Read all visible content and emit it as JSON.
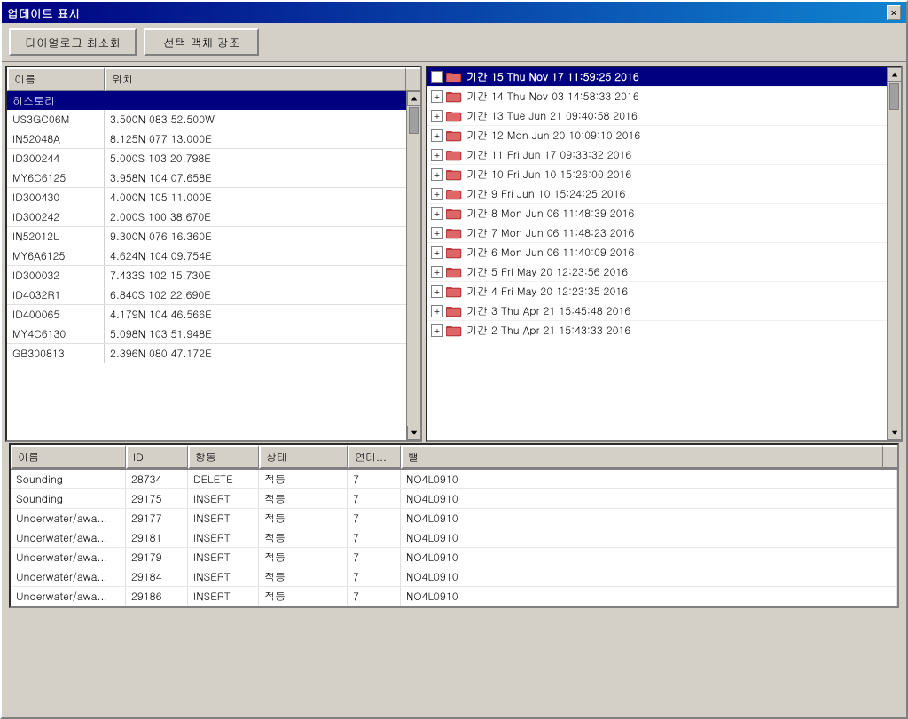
{
  "window": {
    "title": "업데이트 표시",
    "close_label": "×"
  },
  "toolbar": {
    "btn1_label": "다이얼로그 최소화",
    "btn2_label": "선택 객체 강조"
  },
  "left_panel": {
    "col_name": "이름",
    "col_pos": "위치",
    "history_label": "히스토리",
    "rows": [
      {
        "name": "US3GC06M",
        "pos": "3.500N 083 52.500W"
      },
      {
        "name": "IN52048A",
        "pos": "8.125N 077 13.000E"
      },
      {
        "name": "ID300244",
        "pos": "5.000S 103 20.798E"
      },
      {
        "name": "MY6C6125",
        "pos": "3.958N 104 07.658E"
      },
      {
        "name": "ID300430",
        "pos": "4.000N 105 11.000E"
      },
      {
        "name": "ID300242",
        "pos": "2.000S 100 38.670E"
      },
      {
        "name": "IN52012L",
        "pos": "9.300N 076 16.360E"
      },
      {
        "name": "MY6A6125",
        "pos": "4.624N 104 09.754E"
      },
      {
        "name": "ID300032",
        "pos": "7.433S 102 15.730E"
      },
      {
        "name": "ID4032R1",
        "pos": "6.840S 102 22.690E"
      },
      {
        "name": "ID400065",
        "pos": "4.179N 104 46.566E"
      },
      {
        "name": "MY4C6130",
        "pos": "5.098N 103 51.948E"
      },
      {
        "name": "GB300813",
        "pos": "2.396N 080 47.172E"
      }
    ]
  },
  "right_panel": {
    "items": [
      {
        "id": 15,
        "label": "기간 15 Thu Nov 17 11:59:25 2016",
        "selected": true
      },
      {
        "id": 14,
        "label": "기간 14 Thu Nov 03 14:58:33 2016",
        "selected": false
      },
      {
        "id": 13,
        "label": "기간 13 Tue Jun 21 09:40:58 2016",
        "selected": false
      },
      {
        "id": 12,
        "label": "기간 12 Mon Jun 20 10:09:10 2016",
        "selected": false
      },
      {
        "id": 11,
        "label": "기간 11 Fri Jun 17 09:33:32 2016",
        "selected": false
      },
      {
        "id": 10,
        "label": "기간 10 Fri Jun 10 15:26:00 2016",
        "selected": false
      },
      {
        "id": 9,
        "label": "기간 9 Fri Jun 10 15:24:25 2016",
        "selected": false
      },
      {
        "id": 8,
        "label": "기간 8 Mon Jun 06 11:48:39 2016",
        "selected": false
      },
      {
        "id": 7,
        "label": "기간 7 Mon Jun 06 11:48:23 2016",
        "selected": false
      },
      {
        "id": 6,
        "label": "기간 6 Mon Jun 06 11:40:09 2016",
        "selected": false
      },
      {
        "id": 5,
        "label": "기간 5 Fri May 20 12:23:56 2016",
        "selected": false
      },
      {
        "id": 4,
        "label": "기간 4 Fri May 20 12:23:35 2016",
        "selected": false
      },
      {
        "id": 3,
        "label": "기간 3 Thu Apr 21 15:45:48 2016",
        "selected": false
      },
      {
        "id": 2,
        "label": "기간 2 Thu Apr 21 15:43:33 2016",
        "selected": false
      }
    ]
  },
  "bottom_panel": {
    "headers": {
      "name": "이름",
      "id": "ID",
      "action": "항동",
      "status": "상태",
      "priority": "연데...",
      "value": "밸"
    },
    "rows": [
      {
        "name": "Sounding",
        "id": "28734",
        "action": "DELETE",
        "status": "적등",
        "priority": "7",
        "value": "NO4L0910"
      },
      {
        "name": "Sounding",
        "id": "29175",
        "action": "INSERT",
        "status": "적등",
        "priority": "7",
        "value": "NO4L0910"
      },
      {
        "name": "Underwater/awa...",
        "id": "29177",
        "action": "INSERT",
        "status": "적등",
        "priority": "7",
        "value": "NO4L0910"
      },
      {
        "name": "Underwater/awa...",
        "id": "29181",
        "action": "INSERT",
        "status": "적등",
        "priority": "7",
        "value": "NO4L0910"
      },
      {
        "name": "Underwater/awa...",
        "id": "29179",
        "action": "INSERT",
        "status": "적등",
        "priority": "7",
        "value": "NO4L0910"
      },
      {
        "name": "Underwater/awa...",
        "id": "29184",
        "action": "INSERT",
        "status": "적등",
        "priority": "7",
        "value": "NO4L0910"
      },
      {
        "name": "Underwater/awa...",
        "id": "29186",
        "action": "INSERT",
        "status": "적등",
        "priority": "7",
        "value": "NO4L0910"
      }
    ]
  }
}
